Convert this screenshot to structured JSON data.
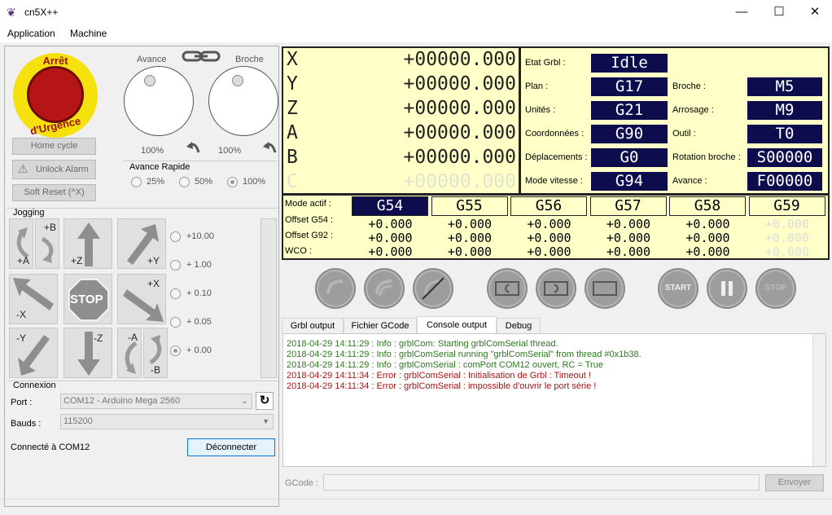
{
  "window": {
    "title": "cn5X++",
    "minimize": "—",
    "maximize": "☐",
    "close": "✕"
  },
  "menu": {
    "application": "Application",
    "machine": "Machine"
  },
  "estop": {
    "line1": "Arrêt",
    "line2": "d'Urgence"
  },
  "feed": {
    "label": "Avance",
    "percent": "100%"
  },
  "spindle": {
    "label": "Broche",
    "percent": "100%"
  },
  "buttons": {
    "home": "Home cycle",
    "unlock": "Unlock Alarm",
    "reset": "Soft Reset (^X)",
    "disconnect": "Déconnecter",
    "send": "Envoyer"
  },
  "rapid": {
    "label": "Avance Rapide",
    "options": [
      "25%",
      "50%",
      "100%"
    ],
    "selected_index": 2
  },
  "jogging": {
    "label": "Jogging",
    "labels": {
      "plus_a": "+A",
      "plus_b": "+B",
      "plus_z": "+Z",
      "plus_y": "+Y",
      "minus_x": "-X",
      "stop": "STOP",
      "plus_x": "+X",
      "minus_y": "-Y",
      "minus_z": "-Z",
      "minus_a": "-A",
      "minus_b": "-B"
    },
    "steps": [
      "+10.00",
      "+ 1.00",
      "+ 0.10",
      "+ 0.05",
      "+ 0.00"
    ],
    "selected_step": 4
  },
  "connection": {
    "label": "Connexion",
    "port_label": "Port :",
    "port_value": "COM12 - Arduino Mega 2560",
    "baud_label": "Bauds :",
    "baud_value": "115200",
    "status": "Connecté à COM12"
  },
  "axes": [
    {
      "name": "X",
      "value": "+00000.000"
    },
    {
      "name": "Y",
      "value": "+00000.000"
    },
    {
      "name": "Z",
      "value": "+00000.000"
    },
    {
      "name": "A",
      "value": "+00000.000"
    },
    {
      "name": "B",
      "value": "+00000.000"
    },
    {
      "name": "C",
      "value": "+00000.000"
    }
  ],
  "state": {
    "etat_label": "Etat Grbl :",
    "etat_value": "Idle",
    "plan_label": "Plan :",
    "plan_value": "G17",
    "unites_label": "Unités :",
    "unites_value": "G21",
    "coord_label": "Coordonnées :",
    "coord_value": "G90",
    "depl_label": "Déplacements :",
    "depl_value": "G0",
    "mode_label": "Mode vitesse :",
    "mode_value": "G94",
    "broche_label": "Broche :",
    "broche_value": "M5",
    "arrosage_label": "Arrosage :",
    "arrosage_value": "M9",
    "outil_label": "Outil :",
    "outil_value": "T0",
    "rotation_label": "Rotation broche :",
    "rotation_value": "S00000",
    "avance_label": "Avance :",
    "avance_value": "F00000"
  },
  "offsets": {
    "mode_label": "Mode actif :",
    "g54_label": "Offset G54 :",
    "g92_label": "Offset G92 :",
    "wco_label": "WCO :",
    "wcs": [
      "G54",
      "G55",
      "G56",
      "G57",
      "G58",
      "G59"
    ],
    "values": "+0.000"
  },
  "cycle": {
    "start": "START",
    "stop": "STOP"
  },
  "tabs": [
    "Grbl output",
    "Fichier GCode",
    "Console output",
    "Debug"
  ],
  "log": [
    {
      "text": "2018-04-29 14:11:29 : Info    : grblCom: Starting grblComSerial thread.",
      "color": "#2a7a1c"
    },
    {
      "text": "2018-04-29 14:11:29 : Info    : grblComSerial running \"grblComSerial\" from thread #0x1b38.",
      "color": "#2a7a1c"
    },
    {
      "text": "2018-04-29 14:11:29 : Info    : grblComSerial : comPort COM12 ouvert, RC = True",
      "color": "#2a7a1c"
    },
    {
      "text": "2018-04-29 14:11:34 : Error  : grblComSerial : Initialisation de Grbl : Timeout !",
      "color": "#b01010"
    },
    {
      "text": "2018-04-29 14:11:34 : Error  : grblComSerial : impossible d'ouvrir le port série !",
      "color": "#b01010"
    }
  ],
  "gcode": {
    "label": "GCode :",
    "placeholder": ""
  }
}
